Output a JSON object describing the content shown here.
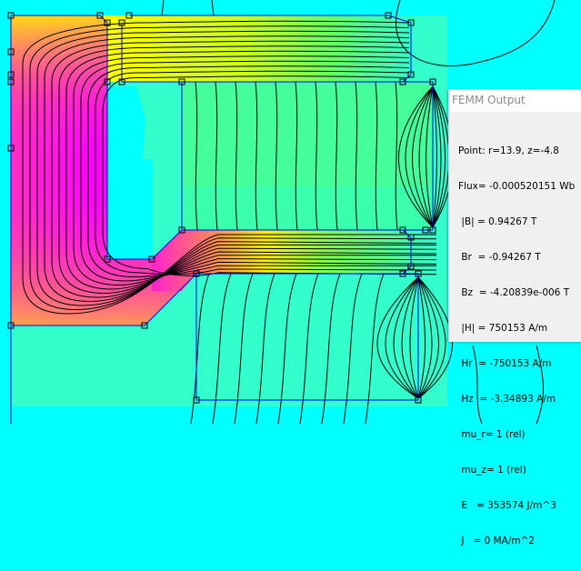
{
  "colors": {
    "background": "#00ffff",
    "geometry": "#0000ff",
    "contour": "#000000",
    "panel": "#f0f0f0"
  },
  "output_window": {
    "title": "FEMM Output",
    "lines": [
      "Point: r=13.9, z=-4.8",
      "Flux= -0.000520151 Wb",
      " |B| = 0.94267 T",
      " Br  = -0.94267 T",
      " Bz  = -4.20839e-006 T",
      " |H| = 750153 A/m",
      " Hr  = -750153 A/m",
      " Hz  = -3.34893 A/m",
      " mu_r= 1 (rel)",
      " mu_z= 1 (rel)",
      " E   = 353574 J/m^3",
      " J   = 0 MA/m^2"
    ]
  }
}
